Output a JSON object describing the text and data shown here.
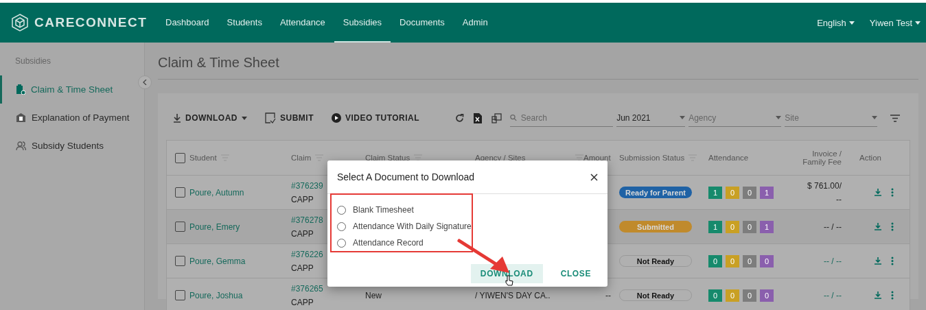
{
  "brand": "CARECONNECT",
  "nav": [
    {
      "label": "Dashboard",
      "selected": false
    },
    {
      "label": "Students",
      "selected": false
    },
    {
      "label": "Attendance",
      "selected": false
    },
    {
      "label": "Subsidies",
      "selected": true
    },
    {
      "label": "Documents",
      "selected": false
    },
    {
      "label": "Admin",
      "selected": false
    }
  ],
  "language": "English",
  "user": "Yiwen Test",
  "sidebar": {
    "heading": "Subsidies",
    "items": [
      {
        "label": "Claim & Time Sheet",
        "kind": "claim",
        "selected": true
      },
      {
        "label": "Explanation of Payment",
        "kind": "payment",
        "selected": false
      },
      {
        "label": "Subsidy Students",
        "kind": "students",
        "selected": false
      }
    ]
  },
  "page_title": "Claim & Time Sheet",
  "toolbar": {
    "buttons": [
      {
        "label": "DOWNLOAD",
        "kind": "download"
      },
      {
        "label": "SUBMIT",
        "kind": "submit"
      },
      {
        "label": "VIDEO TUTORIAL",
        "kind": "video"
      }
    ],
    "search": {
      "placeholder": "Search"
    },
    "filters": [
      {
        "value": "Jun 2021"
      },
      {
        "placeholder": "Agency"
      },
      {
        "placeholder": "Site"
      }
    ]
  },
  "table": {
    "select_all_checked": false,
    "columns": [
      {
        "label": "Student",
        "filter": true
      },
      {
        "label": "Claim",
        "filter": true
      },
      {
        "label": "Claim Status",
        "filter": true
      },
      {
        "label": "Agency / Sites",
        "filter": false
      },
      {
        "label": "Amount",
        "filter": true
      },
      {
        "label": "Submission Status",
        "filter": true
      },
      {
        "label": "Attendance",
        "filter": false
      },
      {
        "label": "Invoice / Family Fee",
        "filter": false
      },
      {
        "label": "Action",
        "filter": false
      }
    ],
    "rows": [
      {
        "checked": false,
        "student": "Poure, Autumn",
        "claim": "#376239",
        "program": "CAPP",
        "submission": {
          "label": "Ready for Parent",
          "kind": "info"
        },
        "attendance": [
          {
            "value": "1",
            "color": "#168a6c"
          },
          {
            "value": "0",
            "color": "#c9a024"
          },
          {
            "value": "0",
            "color": "#7d7d7d"
          },
          {
            "value": "1",
            "color": "#8a5fad"
          }
        ],
        "invoice": "$ 761.00/",
        "fee": "--",
        "link": false
      },
      {
        "checked": false,
        "student": "Poure, Emery",
        "claim": "#376278",
        "program": "CAPP",
        "submission": {
          "label": "Submitted",
          "kind": "warning"
        },
        "attendance": [
          {
            "value": "1",
            "color": "#168a6c"
          },
          {
            "value": "0",
            "color": "#c9a024"
          },
          {
            "value": "0",
            "color": "#7d7d7d"
          },
          {
            "value": "1",
            "color": "#8a5fad"
          }
        ],
        "invoice": "-- / --",
        "link": false
      },
      {
        "checked": false,
        "student": "Poure, Gemma",
        "claim": "#376226",
        "program": "CAPP",
        "submission": {
          "label": "Not Ready",
          "kind": "outline"
        },
        "attendance": [
          {
            "value": "0",
            "color": "#168a6c"
          },
          {
            "value": "0",
            "color": "#c9a024"
          },
          {
            "value": "0",
            "color": "#7d7d7d"
          },
          {
            "value": "0",
            "color": "#8a5fad"
          }
        ],
        "invoice": "-- / --",
        "link": true
      },
      {
        "checked": false,
        "student": "Poure, Joshua",
        "claim": "#376265",
        "program": "CAPP",
        "claim_status": "New",
        "agency": "/ YIWEN'S DAY CA..",
        "amount": "--",
        "submission": {
          "label": "Not Ready",
          "kind": "outline"
        },
        "attendance": [
          {
            "value": "0",
            "color": "#168a6c"
          },
          {
            "value": "0",
            "color": "#c9a024"
          },
          {
            "value": "0",
            "color": "#7d7d7d"
          },
          {
            "value": "0",
            "color": "#8a5fad"
          }
        ],
        "invoice": "-- / --",
        "link": true
      }
    ]
  },
  "dialog": {
    "title": "Select A Document to Download",
    "options": [
      {
        "label": "Blank Timesheet",
        "selected": false
      },
      {
        "label": "Attendance With Daily Signature",
        "selected": false
      },
      {
        "label": "Attendance Record",
        "selected": false
      }
    ],
    "buttons": [
      {
        "label": "DOWNLOAD",
        "kind": "primary"
      },
      {
        "label": "CLOSE",
        "kind": "text"
      }
    ]
  }
}
